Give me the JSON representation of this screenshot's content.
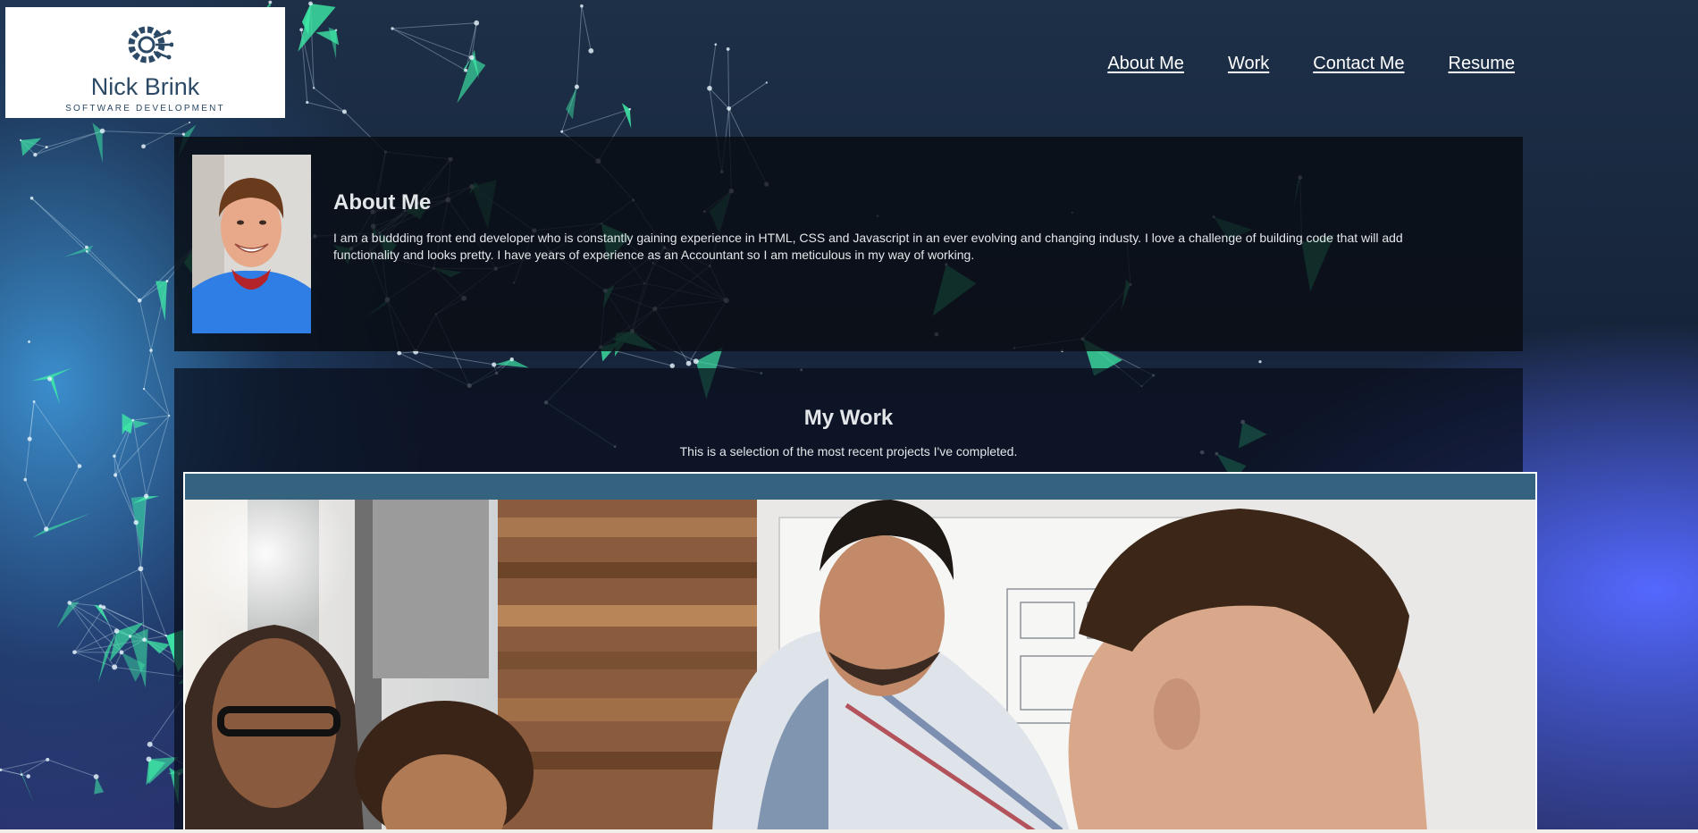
{
  "logo": {
    "name": "Nick Brink",
    "tagline": "SOFTWARE DEVELOPMENT",
    "brand_color": "#2c4a66",
    "icon": "gear-circuit-icon"
  },
  "nav": {
    "items": [
      {
        "label": "About Me"
      },
      {
        "label": "Work"
      },
      {
        "label": "Contact Me"
      },
      {
        "label": "Resume"
      }
    ]
  },
  "about": {
    "title": "About Me",
    "text": "I am a buddding front end developer who is constantly gaining experience in HTML, CSS and Javascript in an ever evolving and changing industy. I love a challenge of building code that will add functionality and looks pretty. I have years of experience as an Accountant so I am meticulous in my way of working."
  },
  "work": {
    "title": "My Work",
    "subtitle": "This is a selection of the most recent projects I've completed.",
    "card_header_color": "#35637f"
  },
  "colors": {
    "network_accent": "#3ee8a6",
    "panel_text": "#e3e7ea"
  }
}
